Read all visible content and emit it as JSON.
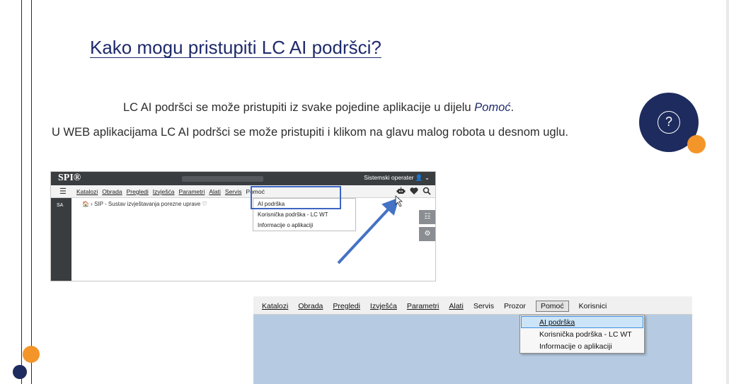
{
  "slide": {
    "title": "Kako mogu pristupiti LC AI podršci?",
    "line1_text": "LC AI podršci se može pristupiti iz svake pojedine aplikacije u dijelu ",
    "line1_emph": "Pomoć",
    "line1_end": ".",
    "line2_text": "U WEB aplikacijama LC AI podršci se može pristupiti i klikom na glavu malog robota u desnom uglu.",
    "help_icon_glyph": "?"
  },
  "colors": {
    "navy": "#1e2b5e",
    "orange": "#f4952a",
    "title_blue": "#1f2a6b",
    "highlight_blue": "#3b66c3"
  },
  "web_app": {
    "logo": "SPI®",
    "user_label": "Sistemski operater 👤 ⌄",
    "hamburger": "☰",
    "menu": [
      "Katalozi",
      "Obrada",
      "Pregledi",
      "Izvješća",
      "Parametri",
      "Alati",
      "Servis",
      "Pomoć"
    ],
    "icons": [
      "robot-icon",
      "heart-icon",
      "search-icon"
    ],
    "sidebar_label": "SA",
    "breadcrumb": "🏠  ›  SIP - Sustav izvještavanja porezne uprave   ♡",
    "dropdown": [
      "AI podrška",
      "Korisnička podrška - LC WT",
      "Informacije o aplikaciji"
    ],
    "side_buttons": [
      "☷",
      "⚙"
    ]
  },
  "desktop_app": {
    "menu": [
      "Katalozi",
      "Obrada",
      "Pregledi",
      "Izvješća",
      "Parametri",
      "Alati",
      "Servis",
      "Prozor",
      "Pomoć",
      "Korisnici"
    ],
    "dropdown": [
      "AI podrška",
      "Korisnička podrška - LC WT",
      "Informacije o aplikaciji"
    ]
  }
}
